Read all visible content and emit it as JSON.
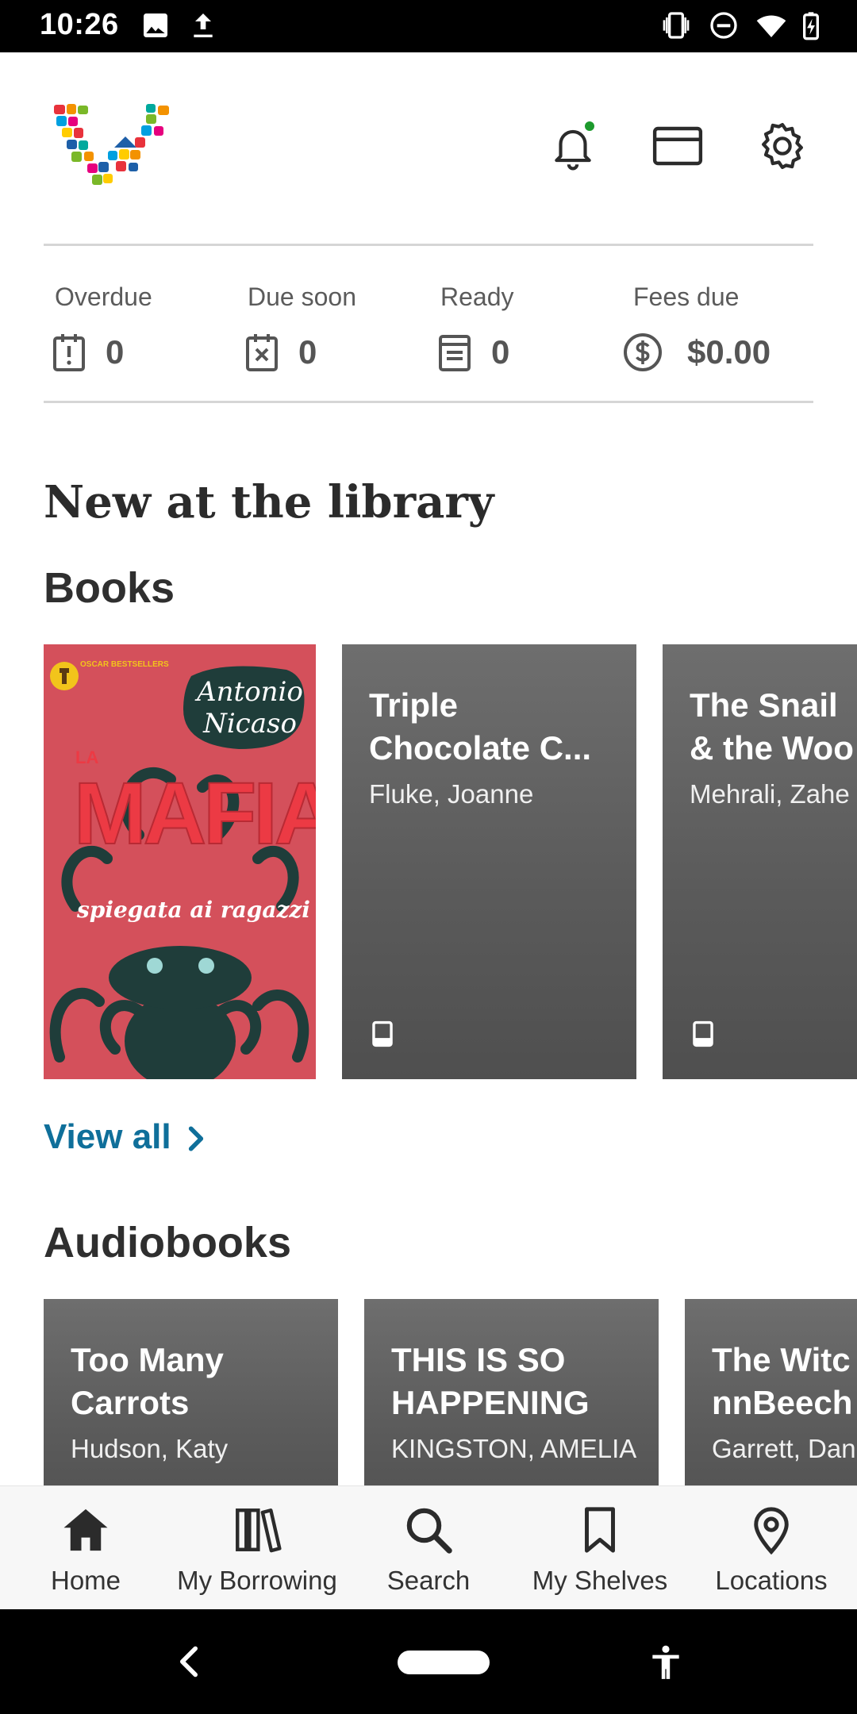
{
  "status_bar": {
    "time": "10:26",
    "left_icons": [
      "image-icon",
      "upload-icon"
    ],
    "right_icons": [
      "vibrate-icon",
      "do-not-disturb-icon",
      "wifi-icon",
      "battery-charging-icon"
    ]
  },
  "header": {
    "logo": "library-logo",
    "icons": [
      "bell-icon",
      "card-icon",
      "gear-icon"
    ],
    "notification_dot_color": "#1d9a2d"
  },
  "summary": [
    {
      "label": "Overdue",
      "value": "0",
      "icon": "calendar-alert-icon"
    },
    {
      "label": "Due soon",
      "value": "0",
      "icon": "calendar-x-icon"
    },
    {
      "label": "Ready",
      "value": "0",
      "icon": "book-ready-icon"
    },
    {
      "label": "Fees due",
      "value": "$0.00",
      "icon": "dollar-circle-icon"
    }
  ],
  "main": {
    "title": "New at the library",
    "books": {
      "heading": "Books",
      "cover": {
        "series": "OSCAR BESTSELLERS",
        "author": "Antonio Nicaso",
        "title_big": "MAFIA",
        "title_prefix": "LA",
        "subtitle": "spiegata ai ragazzi"
      },
      "cards": [
        {
          "title_line1": "Triple",
          "title_line2": "Chocolate C...",
          "author": "Fluke, Joanne",
          "icon": "tablet-icon"
        },
        {
          "title_line1": "The Snail",
          "title_line2": "& the Woo",
          "author": "Mehrali, Zahe",
          "icon": "tablet-icon"
        }
      ],
      "view_all": "View all"
    },
    "audiobooks": {
      "heading": "Audiobooks",
      "cards": [
        {
          "title_line1": "Too Many",
          "title_line2": "Carrots",
          "author": "Hudson, Katy"
        },
        {
          "title_line1": "THIS IS SO",
          "title_line2": "HAPPENING",
          "author": "KINGSTON, AMELIA"
        },
        {
          "title_line1": "The Witc",
          "title_line2": "nnBeech",
          "author": "Garrett, Dan"
        }
      ]
    }
  },
  "bottom_nav": [
    {
      "label": "Home",
      "icon": "home-icon",
      "active": true
    },
    {
      "label": "My Borrowing",
      "icon": "books-icon",
      "active": false
    },
    {
      "label": "Search",
      "icon": "search-icon",
      "active": false
    },
    {
      "label": "My Shelves",
      "icon": "bookmark-icon",
      "active": false
    },
    {
      "label": "Locations",
      "icon": "location-pin-icon",
      "active": false
    }
  ],
  "system_nav": {
    "icons": [
      "back-icon",
      "home-pill-icon",
      "accessibility-icon"
    ]
  },
  "colors": {
    "accent_link": "#0f6f9a",
    "card_bg": "#5e5e5e"
  }
}
